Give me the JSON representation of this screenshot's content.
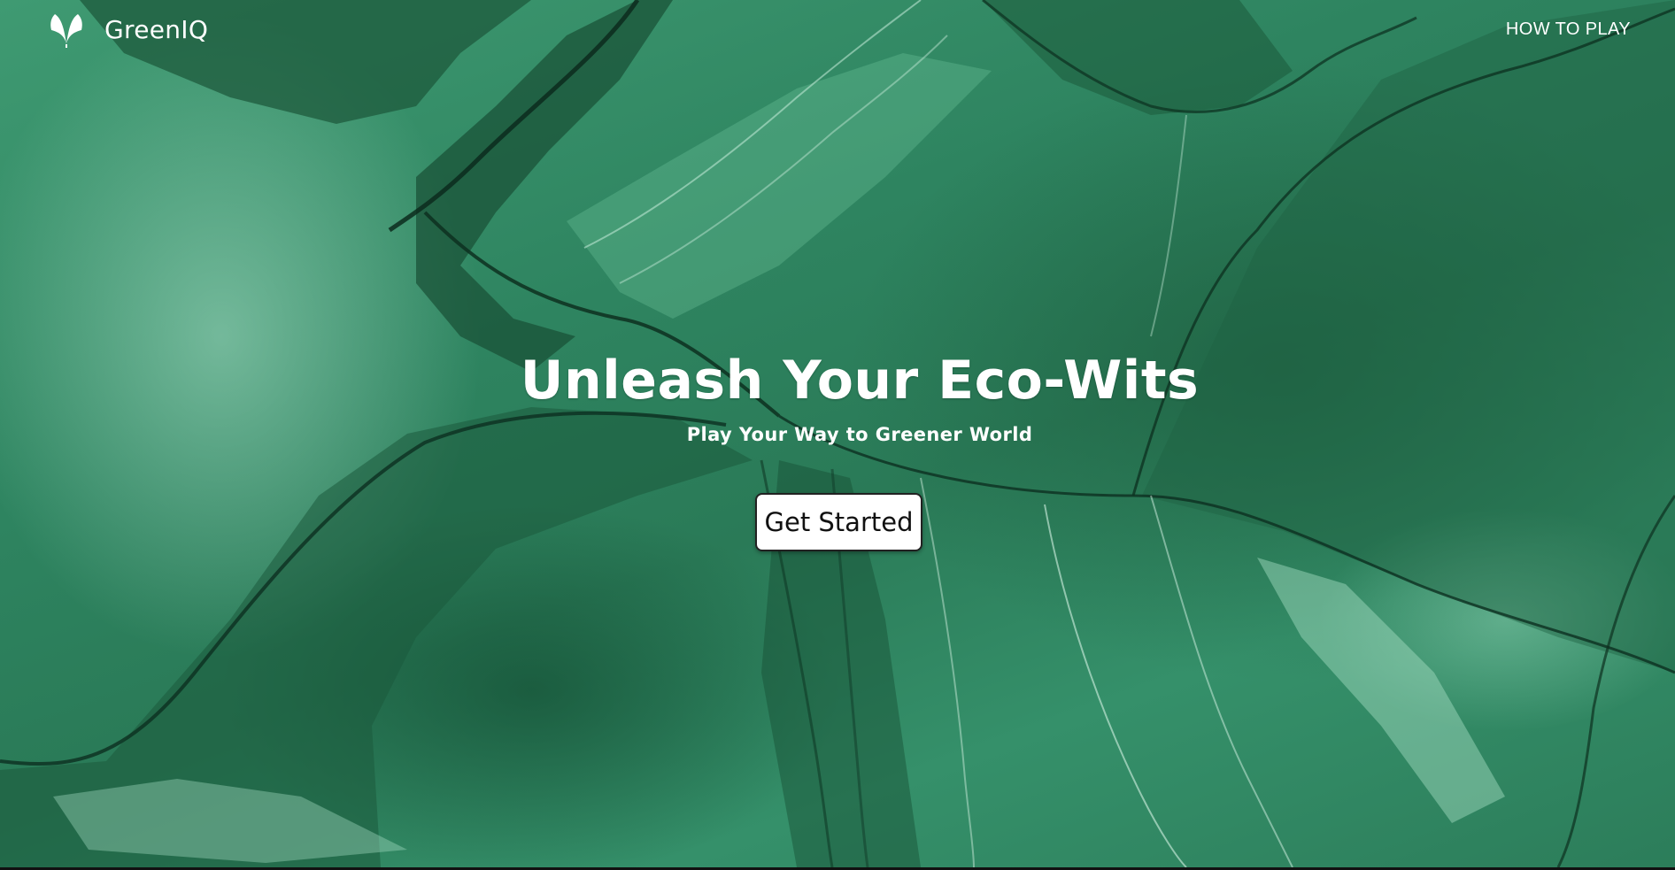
{
  "brand": {
    "name": "GreenIQ",
    "logo_icon": "leaf-icon"
  },
  "nav": {
    "how_to_play": "HOW TO PLAY"
  },
  "hero": {
    "title": "Unleash Your Eco-Wits",
    "subtitle": "Play Your Way to Greener World",
    "cta_label": "Get Started"
  },
  "theme": {
    "background": "#2e8460",
    "text": "#ffffff",
    "button_bg": "#ffffff",
    "button_text": "#111111"
  }
}
